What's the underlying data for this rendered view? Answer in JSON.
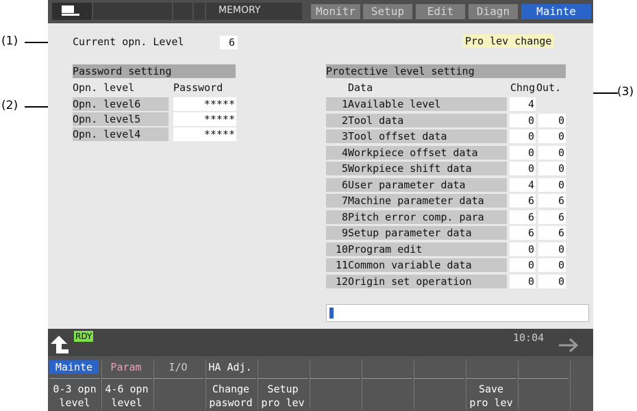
{
  "callouts": {
    "c1": "(1)",
    "c2": "(2)",
    "c3": "(3)"
  },
  "header": {
    "mode": "MEMORY",
    "tabs": [
      "Monitr",
      "Setup",
      "Edit",
      "Diagn",
      "Mainte"
    ]
  },
  "current_level": {
    "label": "Current opn. Level",
    "value": "6"
  },
  "pro_lev_change": "Pro lev change",
  "password_setting": {
    "title": "Password setting",
    "col_level": "Opn. level",
    "col_password": "Password",
    "rows": [
      {
        "level": "Opn. level6",
        "password": "*****"
      },
      {
        "level": "Opn. level5",
        "password": "*****"
      },
      {
        "level": "Opn. level4",
        "password": "*****"
      }
    ]
  },
  "protective": {
    "title": "Protective level setting",
    "col_data": "Data",
    "col_chng": "Chng",
    "col_out": "Out.",
    "rows": [
      {
        "no": "1",
        "name": "Available level",
        "chng": "4",
        "out": ""
      },
      {
        "no": "2",
        "name": "Tool data",
        "chng": "0",
        "out": "0"
      },
      {
        "no": "3",
        "name": "Tool offset data",
        "chng": "0",
        "out": "0"
      },
      {
        "no": "4",
        "name": "Workpiece offset data",
        "chng": "0",
        "out": "0"
      },
      {
        "no": "5",
        "name": "Workpiece shift data",
        "chng": "0",
        "out": "0"
      },
      {
        "no": "6",
        "name": "User parameter data",
        "chng": "4",
        "out": "0"
      },
      {
        "no": "7",
        "name": "Machine parameter data",
        "chng": "6",
        "out": "6"
      },
      {
        "no": "8",
        "name": "Pitch error comp. para",
        "chng": "6",
        "out": "6"
      },
      {
        "no": "9",
        "name": "Setup parameter data",
        "chng": "6",
        "out": "6"
      },
      {
        "no": "10",
        "name": "Program edit",
        "chng": "0",
        "out": "0"
      },
      {
        "no": "11",
        "name": "Common variable data",
        "chng": "0",
        "out": "0"
      },
      {
        "no": "12",
        "name": "Origin set operation",
        "chng": "0",
        "out": "0"
      }
    ]
  },
  "status": {
    "rdy": "RDY",
    "time": "10:04"
  },
  "menu": {
    "upper": [
      "Mainte",
      "Param",
      "I/O",
      "HA Adj."
    ],
    "keys": [
      [
        "0-3 opn",
        "level"
      ],
      [
        "4-6 opn",
        "level"
      ],
      [
        "",
        ""
      ],
      [
        "Change",
        "pasword"
      ],
      [
        "Setup",
        "pro lev"
      ],
      [
        "",
        ""
      ],
      [
        "",
        ""
      ],
      [
        "",
        ""
      ],
      [
        "Save",
        "pro lev"
      ],
      [
        "",
        ""
      ]
    ]
  },
  "colors": {
    "accent": "#2a64c8",
    "rdy": "#7fe04a",
    "highlight": "#f7f3c0"
  }
}
